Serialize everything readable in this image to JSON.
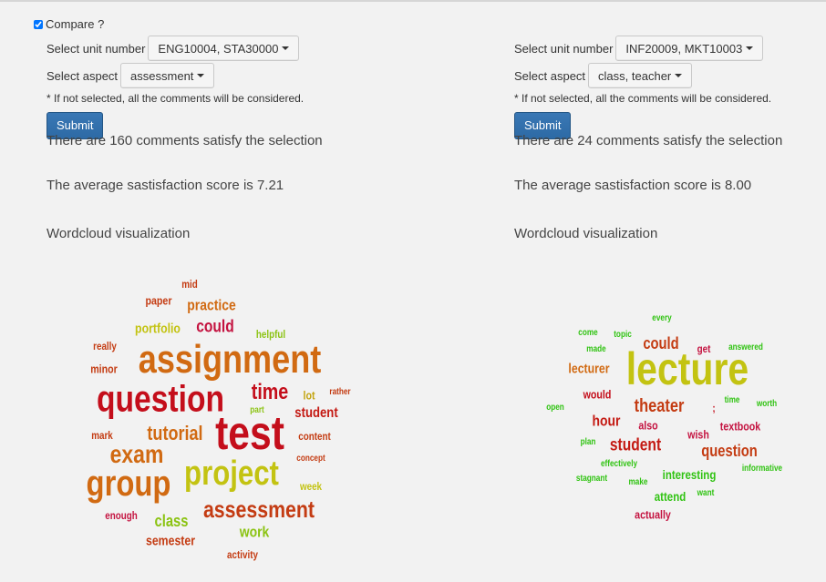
{
  "compare": {
    "label": "Compare ?",
    "checked": true
  },
  "left": {
    "unit_label": "Select unit number",
    "unit_value": "ENG10004, STA30000",
    "aspect_label": "Select aspect",
    "aspect_value": "assessment",
    "note": "* If not selected, all the comments will be considered.",
    "submit_label": "Submit",
    "comments_text": "There are 160 comments satisfy the selection",
    "score_text": "The average sastisfaction score is 7.21",
    "wordcloud_title": "Wordcloud visualization",
    "words": [
      {
        "text": "mid",
        "color": "#c43c13"
      },
      {
        "text": "paper",
        "color": "#c43c13"
      },
      {
        "text": "practice",
        "color": "#d16a12"
      },
      {
        "text": "portfolio",
        "color": "#c3c312"
      },
      {
        "text": "could",
        "color": "#c41340"
      },
      {
        "text": "helpful",
        "color": "#8bc312"
      },
      {
        "text": "really",
        "color": "#c43c13"
      },
      {
        "text": "assignment",
        "color": "#d16a12"
      },
      {
        "text": "minor",
        "color": "#c43c13"
      },
      {
        "text": "question",
        "color": "#c40e1b"
      },
      {
        "text": "time",
        "color": "#c40e1b"
      },
      {
        "text": "lot",
        "color": "#c3a512"
      },
      {
        "text": "rather",
        "color": "#c43c13"
      },
      {
        "text": "part",
        "color": "#8bc312"
      },
      {
        "text": "student",
        "color": "#c41a13"
      },
      {
        "text": "mark",
        "color": "#c43c13"
      },
      {
        "text": "tutorial",
        "color": "#d16a12"
      },
      {
        "text": "test",
        "color": "#c40e1b"
      },
      {
        "text": "content",
        "color": "#c43c13"
      },
      {
        "text": "exam",
        "color": "#d16a12"
      },
      {
        "text": "concept",
        "color": "#c43c13"
      },
      {
        "text": "group",
        "color": "#d16a12"
      },
      {
        "text": "project",
        "color": "#c3c312"
      },
      {
        "text": "week",
        "color": "#c3c312"
      },
      {
        "text": "enough",
        "color": "#c41340"
      },
      {
        "text": "class",
        "color": "#8bc312"
      },
      {
        "text": "assessment",
        "color": "#c43c13"
      },
      {
        "text": "work",
        "color": "#8bc312"
      },
      {
        "text": "semester",
        "color": "#c43c13"
      },
      {
        "text": "activity",
        "color": "#c43c13"
      }
    ]
  },
  "right": {
    "unit_label": "Select unit number",
    "unit_value": "INF20009, MKT10003",
    "aspect_label": "Select aspect",
    "aspect_value": "class, teacher",
    "note": "* If not selected, all the comments will be considered.",
    "submit_label": "Submit",
    "comments_text": "There are 24 comments satisfy the selection",
    "score_text": "The average sastisfaction score is 8.00",
    "wordcloud_title": "Wordcloud visualization",
    "words": [
      {
        "text": "every",
        "color": "#30c312"
      },
      {
        "text": "come",
        "color": "#30c312"
      },
      {
        "text": "topic",
        "color": "#30c312"
      },
      {
        "text": "could",
        "color": "#c43c13"
      },
      {
        "text": "made",
        "color": "#30c312"
      },
      {
        "text": "get",
        "color": "#c41340"
      },
      {
        "text": "answered",
        "color": "#30c312"
      },
      {
        "text": "lecturer",
        "color": "#d16a12"
      },
      {
        "text": "lecture",
        "color": "#c3c312"
      },
      {
        "text": "would",
        "color": "#c40e1b"
      },
      {
        "text": "time",
        "color": "#30c312"
      },
      {
        "text": "worth",
        "color": "#30c312"
      },
      {
        "text": "open",
        "color": "#30c312"
      },
      {
        "text": "theater",
        "color": "#c43c13"
      },
      {
        "text": ";",
        "color": "#c40e1b"
      },
      {
        "text": "hour",
        "color": "#c41a13"
      },
      {
        "text": "also",
        "color": "#c41340"
      },
      {
        "text": "wish",
        "color": "#c41340"
      },
      {
        "text": "textbook",
        "color": "#c41340"
      },
      {
        "text": "plan",
        "color": "#30c312"
      },
      {
        "text": "student",
        "color": "#c41a13"
      },
      {
        "text": "question",
        "color": "#c43c13"
      },
      {
        "text": "effectively",
        "color": "#30c312"
      },
      {
        "text": "informative",
        "color": "#30c312"
      },
      {
        "text": "stagnant",
        "color": "#30c312"
      },
      {
        "text": "make",
        "color": "#30c312"
      },
      {
        "text": "interesting",
        "color": "#30c312"
      },
      {
        "text": "attend",
        "color": "#30c312"
      },
      {
        "text": "want",
        "color": "#30c312"
      },
      {
        "text": "actually",
        "color": "#c41340"
      }
    ]
  }
}
